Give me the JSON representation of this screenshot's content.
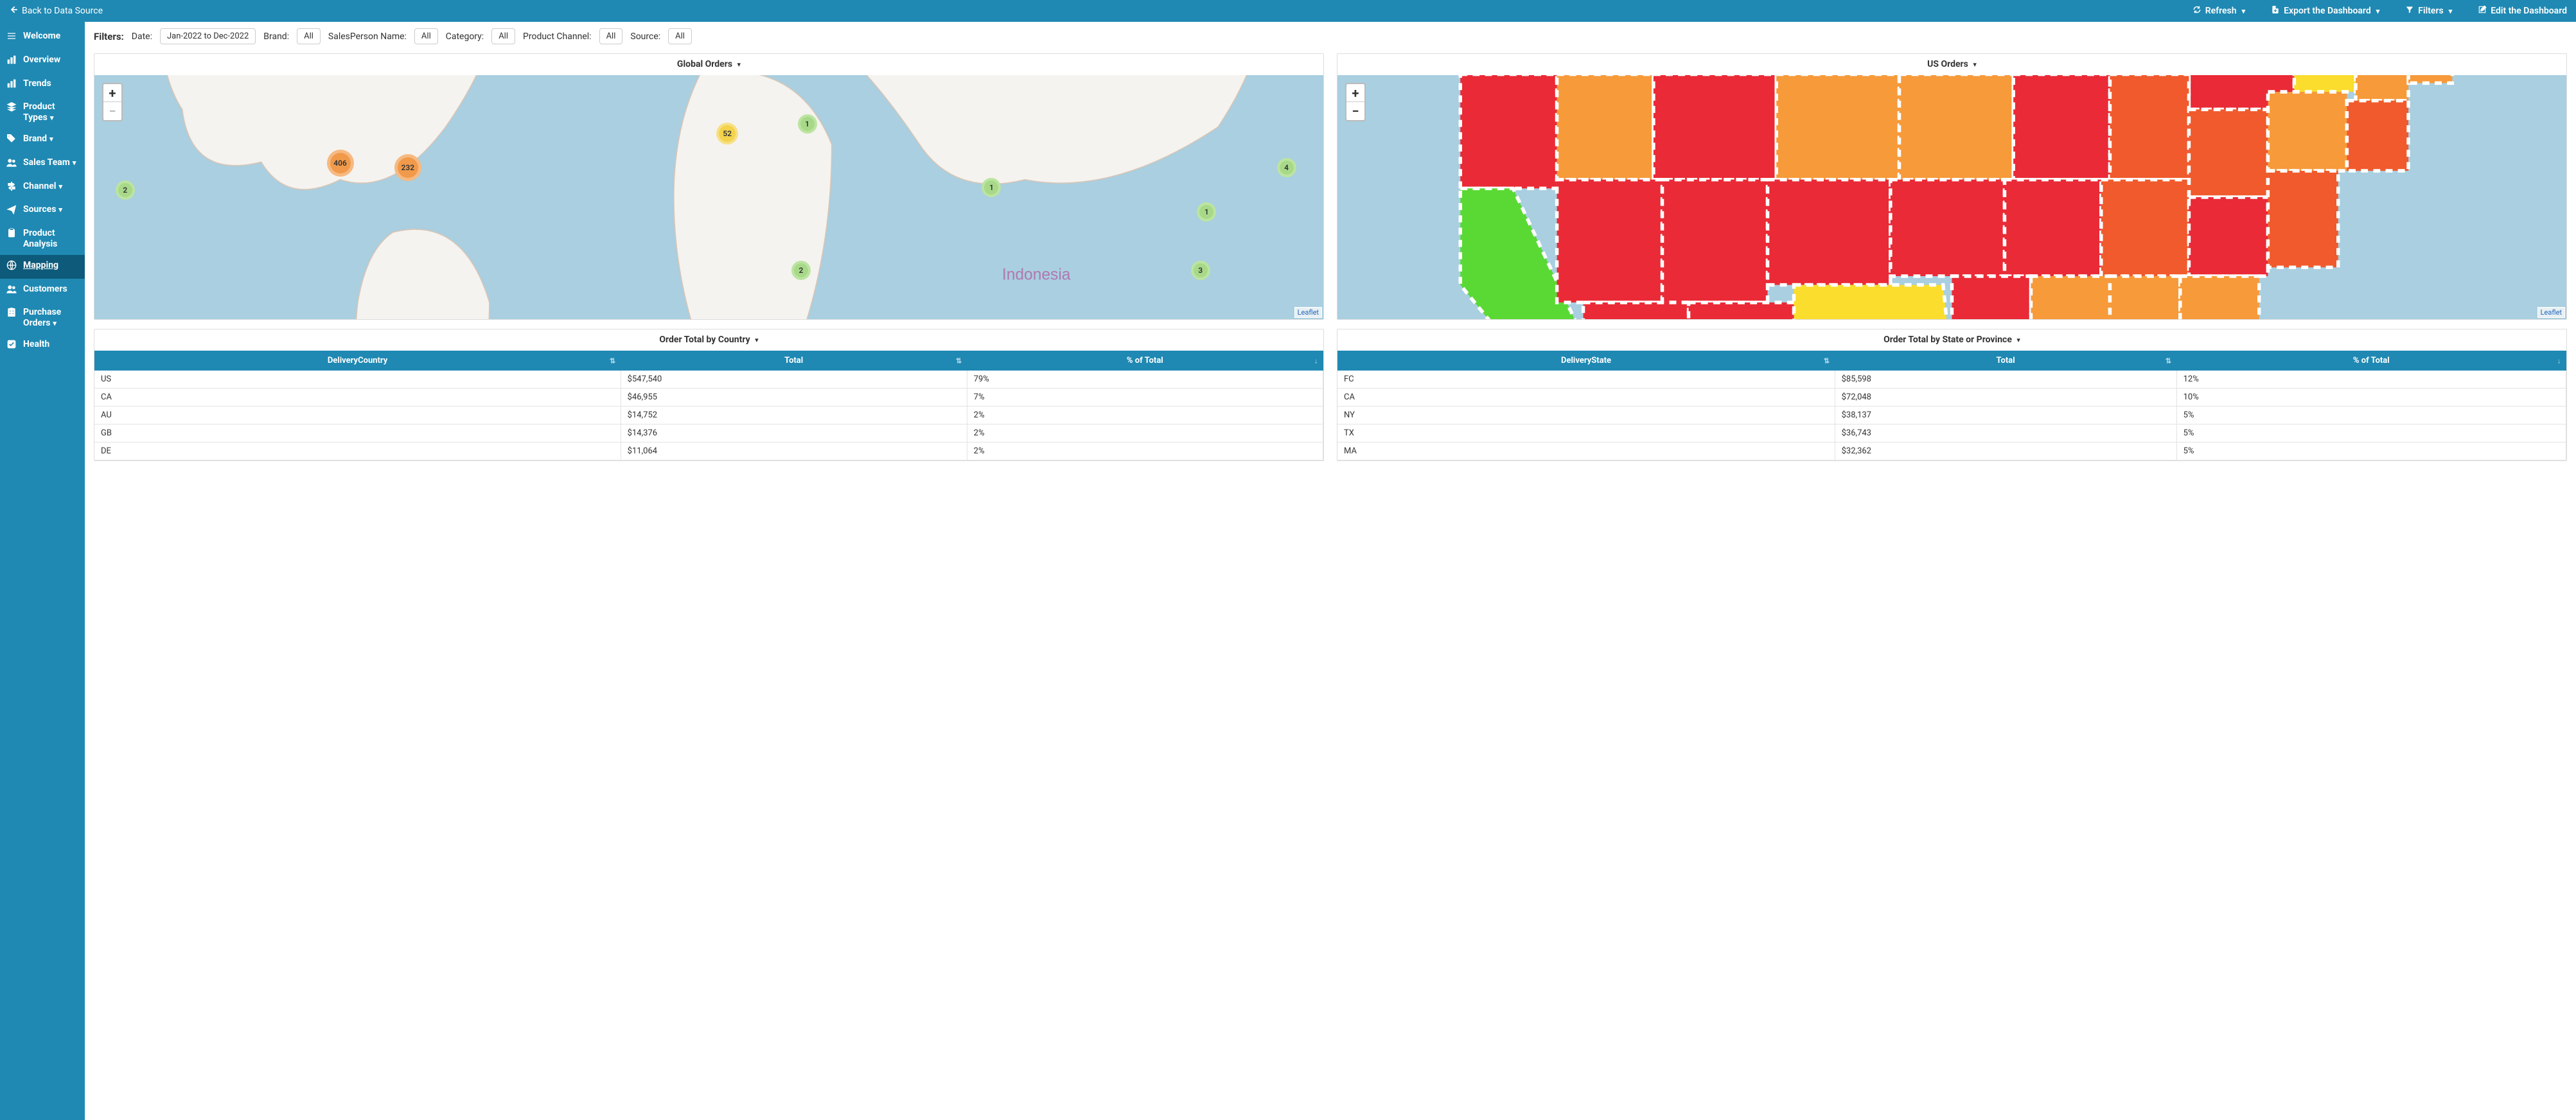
{
  "topbar": {
    "back_label": "Back to Data Source",
    "refresh": "Refresh",
    "export": "Export the Dashboard",
    "filters": "Filters",
    "edit": "Edit the Dashboard"
  },
  "sidebar": {
    "items": [
      {
        "id": "welcome",
        "label": "Welcome",
        "icon": "menu",
        "caret": false
      },
      {
        "id": "overview",
        "label": "Overview",
        "icon": "barchart",
        "caret": false
      },
      {
        "id": "trends",
        "label": "Trends",
        "icon": "barchart",
        "caret": false
      },
      {
        "id": "product-types",
        "label": "Product Types",
        "icon": "layers",
        "caret": true
      },
      {
        "id": "brand",
        "label": "Brand",
        "icon": "tag",
        "caret": true
      },
      {
        "id": "sales-team",
        "label": "Sales Team",
        "icon": "users",
        "caret": true
      },
      {
        "id": "channel",
        "label": "Channel",
        "icon": "signpost",
        "caret": true
      },
      {
        "id": "sources",
        "label": "Sources",
        "icon": "send",
        "caret": true
      },
      {
        "id": "product-analysis",
        "label": "Product Analysis",
        "icon": "clipboard",
        "caret": false
      },
      {
        "id": "mapping",
        "label": "Mapping",
        "icon": "globe",
        "caret": false,
        "active": true
      },
      {
        "id": "customers",
        "label": "Customers",
        "icon": "users",
        "caret": false
      },
      {
        "id": "purchase-orders",
        "label": "Purchase Orders",
        "icon": "building",
        "caret": true
      },
      {
        "id": "health",
        "label": "Health",
        "icon": "check-square",
        "caret": false
      }
    ]
  },
  "filters": {
    "label": "Filters:",
    "items": [
      {
        "label": "Date:",
        "value": "Jan-2022 to Dec-2022"
      },
      {
        "label": "Brand:",
        "value": "All"
      },
      {
        "label": "SalesPerson Name:",
        "value": "All"
      },
      {
        "label": "Category:",
        "value": "All"
      },
      {
        "label": "Product Channel:",
        "value": "All"
      },
      {
        "label": "Source:",
        "value": "All"
      }
    ]
  },
  "panels": {
    "global_orders": {
      "title": "Global Orders",
      "leaflet": "Leaflet",
      "clusters": [
        {
          "val": "406",
          "class": "orange",
          "left": "20%",
          "top": "36%"
        },
        {
          "val": "232",
          "class": "orange",
          "left": "25.5%",
          "top": "38%"
        },
        {
          "val": "52",
          "class": "yellow",
          "left": "51.5%",
          "top": "24%"
        },
        {
          "val": "1",
          "class": "green",
          "left": "58%",
          "top": "20%"
        },
        {
          "val": "4",
          "class": "green",
          "left": "97%",
          "top": "38%"
        },
        {
          "val": "1",
          "class": "green",
          "left": "73%",
          "top": "46%"
        },
        {
          "val": "1",
          "class": "green",
          "left": "90.5%",
          "top": "56%"
        },
        {
          "val": "3",
          "class": "green",
          "left": "90%",
          "top": "80%"
        },
        {
          "val": "2",
          "class": "green",
          "left": "57.5%",
          "top": "80%"
        },
        {
          "val": "2",
          "class": "green",
          "left": "2.5%",
          "top": "47%"
        }
      ]
    },
    "us_orders": {
      "title": "US Orders",
      "leaflet": "Leaflet"
    },
    "order_total_country": {
      "title": "Order Total by Country",
      "columns": [
        "DeliveryCountry",
        "Total",
        "% of Total"
      ],
      "rows": [
        [
          "US",
          "$547,540",
          "79%"
        ],
        [
          "CA",
          "$46,955",
          "7%"
        ],
        [
          "AU",
          "$14,752",
          "2%"
        ],
        [
          "GB",
          "$14,376",
          "2%"
        ],
        [
          "DE",
          "$11,064",
          "2%"
        ]
      ]
    },
    "order_total_state": {
      "title": "Order Total by State or Province",
      "columns": [
        "DeliveryState",
        "Total",
        "% of Total"
      ],
      "rows": [
        [
          "FC",
          "$85,598",
          "12%"
        ],
        [
          "CA",
          "$72,048",
          "10%"
        ],
        [
          "NY",
          "$38,137",
          "5%"
        ],
        [
          "TX",
          "$36,743",
          "5%"
        ],
        [
          "MA",
          "$32,362",
          "5%"
        ]
      ]
    }
  },
  "chart_data": [
    {
      "type": "map",
      "title": "Global Orders",
      "projection": "world",
      "cluster_markers": [
        {
          "label": "406"
        },
        {
          "label": "232"
        },
        {
          "label": "52"
        },
        {
          "label": "1"
        },
        {
          "label": "4"
        },
        {
          "label": "1"
        },
        {
          "label": "1"
        },
        {
          "label": "3"
        },
        {
          "label": "2"
        },
        {
          "label": "2"
        }
      ]
    },
    {
      "type": "map",
      "title": "US Orders",
      "projection": "usa",
      "note": "Choropleth colored states: CA=green, TX=yellow, NY=yellow, most=red, several=orange"
    },
    {
      "type": "table",
      "title": "Order Total by Country",
      "columns": [
        "DeliveryCountry",
        "Total",
        "% of Total"
      ],
      "rows": [
        [
          "US",
          547540,
          79
        ],
        [
          "CA",
          46955,
          7
        ],
        [
          "AU",
          14752,
          2
        ],
        [
          "GB",
          14376,
          2
        ],
        [
          "DE",
          11064,
          2
        ]
      ]
    },
    {
      "type": "table",
      "title": "Order Total by State or Province",
      "columns": [
        "DeliveryState",
        "Total",
        "% of Total"
      ],
      "rows": [
        [
          "FC",
          85598,
          12
        ],
        [
          "CA",
          72048,
          10
        ],
        [
          "NY",
          38137,
          5
        ],
        [
          "TX",
          36743,
          5
        ],
        [
          "MA",
          32362,
          5
        ]
      ]
    }
  ]
}
